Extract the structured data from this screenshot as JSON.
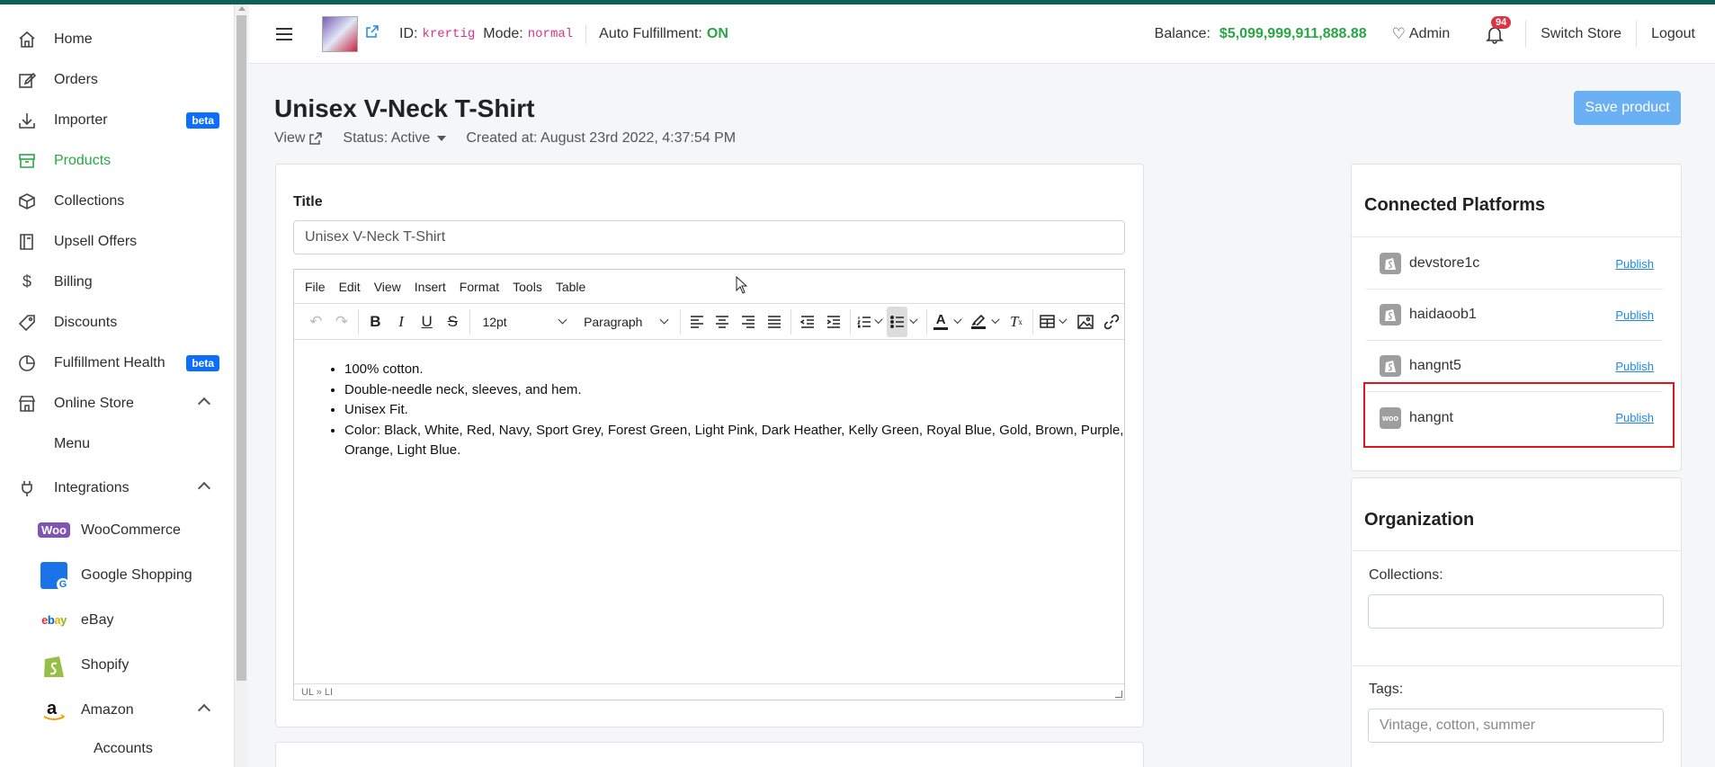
{
  "sidebar": {
    "items": [
      {
        "label": "Home",
        "icon": "home-icon"
      },
      {
        "label": "Orders",
        "icon": "edit-icon"
      },
      {
        "label": "Importer",
        "icon": "download-icon",
        "badge": "beta"
      },
      {
        "label": "Products",
        "icon": "archive-icon",
        "active": true
      },
      {
        "label": "Collections",
        "icon": "cube-icon"
      },
      {
        "label": "Upsell Offers",
        "icon": "book-icon"
      },
      {
        "label": "Billing",
        "icon": "dollar-icon"
      },
      {
        "label": "Discounts",
        "icon": "tag-icon"
      },
      {
        "label": "Fulfillment Health",
        "icon": "pie-chart-icon",
        "badge": "beta"
      },
      {
        "label": "Online Store",
        "icon": "store-icon",
        "expanded": true
      }
    ],
    "online_store_sub": {
      "label": "Menu"
    },
    "integrations": {
      "label": "Integrations",
      "icon": "plug-icon",
      "expanded": true
    },
    "integration_items": [
      {
        "label": "WooCommerce",
        "icon": "woocommerce-icon"
      },
      {
        "label": "Google Shopping",
        "icon": "google-shopping-icon"
      },
      {
        "label": "eBay",
        "icon": "ebay-icon"
      },
      {
        "label": "Shopify",
        "icon": "shopify-icon"
      },
      {
        "label": "Amazon",
        "icon": "amazon-icon",
        "expanded": true
      }
    ],
    "amazon_sub": {
      "label": "Accounts"
    },
    "woo_text": "Woo",
    "ebay_text": "ebay",
    "google_text": "G"
  },
  "header": {
    "id_label": "ID:",
    "id_value": "krertig",
    "mode_label": "Mode:",
    "mode_value": "normal",
    "auto_label": "Auto Fulfillment:",
    "auto_value": "ON",
    "balance_label": "Balance:",
    "balance_value": "$5,099,999,911,888.88",
    "admin_label": "Admin",
    "notifications_count": "94",
    "switch_store_label": "Switch Store",
    "logout_label": "Logout"
  },
  "page": {
    "title": "Unisex V-Neck T-Shirt",
    "view_label": "View",
    "status_label": "Status: Active",
    "created_label": "Created at: August 23rd 2022, 4:37:54 PM",
    "save_label": "Save product"
  },
  "form": {
    "title_label": "Title",
    "title_value": "Unisex V-Neck T-Shirt"
  },
  "editor": {
    "menu": [
      "File",
      "Edit",
      "View",
      "Insert",
      "Format",
      "Tools",
      "Table"
    ],
    "font_size": "12pt",
    "block_format": "Paragraph",
    "content": [
      "100% cotton.",
      "Double-needle neck, sleeves, and hem.",
      "Unisex Fit.",
      "Color: Black, White, Red, Navy, Sport Grey, Forest Green, Light Pink, Dark Heather, Kelly Green, Royal Blue, Gold, Brown, Purple, Orange, Light Blue."
    ],
    "status_path": "UL » LI"
  },
  "connected_platforms": {
    "title": "Connected Platforms",
    "publish_label": "Publish",
    "platforms": [
      {
        "name": "devstore1c",
        "type": "shopify"
      },
      {
        "name": "haidaoob1",
        "type": "shopify"
      },
      {
        "name": "hangnt5",
        "type": "shopify"
      },
      {
        "name": "hangnt",
        "type": "woocommerce",
        "highlighted": true
      }
    ],
    "woo_icon_text": "woo"
  },
  "organization": {
    "title": "Organization",
    "collections_label": "Collections:",
    "collections_value": "",
    "tags_label": "Tags:",
    "tags_placeholder": "Vintage, cotton, summer"
  },
  "colors": {
    "accent_green": "#28a745",
    "primary_blue": "#0d6efd",
    "highlight_red": "#e0161e",
    "badge_red": "#dc3545"
  }
}
